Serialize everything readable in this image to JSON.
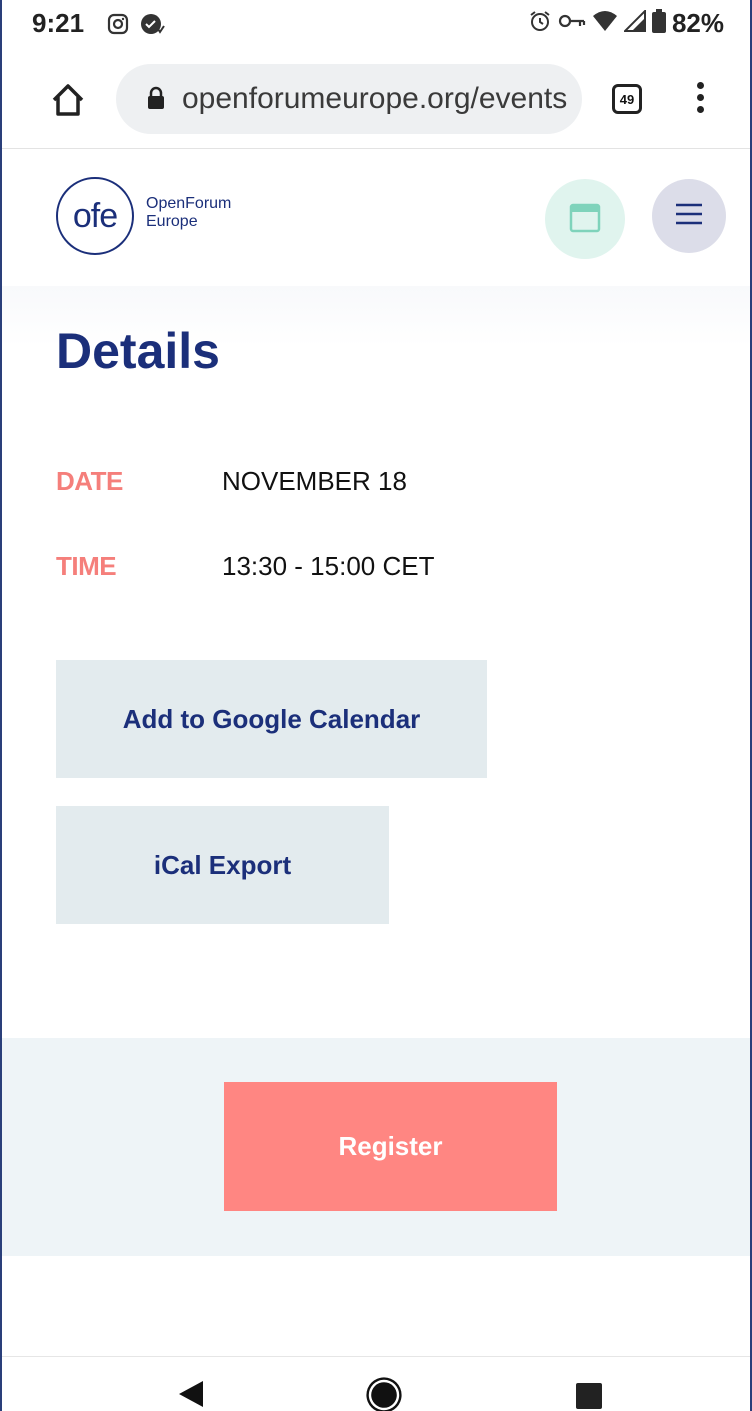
{
  "status_bar": {
    "time": "9:21",
    "battery": "82%",
    "icons": [
      "instagram-icon",
      "vpn-check-icon",
      "alarm-icon",
      "key-icon",
      "wifi-icon",
      "signal-icon",
      "battery-icon"
    ]
  },
  "browser": {
    "url": "openforumeurope.org/events",
    "tab_count": "49"
  },
  "site": {
    "logo_mark": "ofe",
    "logo_line1": "OpenForum",
    "logo_line2": "Europe"
  },
  "details": {
    "title": "Details",
    "rows": [
      {
        "label": "DATE",
        "value": "NOVEMBER 18"
      },
      {
        "label": "TIME",
        "value": "13:30 - 15:00 CET"
      }
    ],
    "google_calendar_label": "Add to Google Calendar",
    "ical_label": "iCal Export"
  },
  "register": {
    "label": "Register"
  },
  "colors": {
    "brand_navy": "#1b2f7a",
    "accent_coral": "#ff8682",
    "label_coral": "#f57f7b"
  }
}
